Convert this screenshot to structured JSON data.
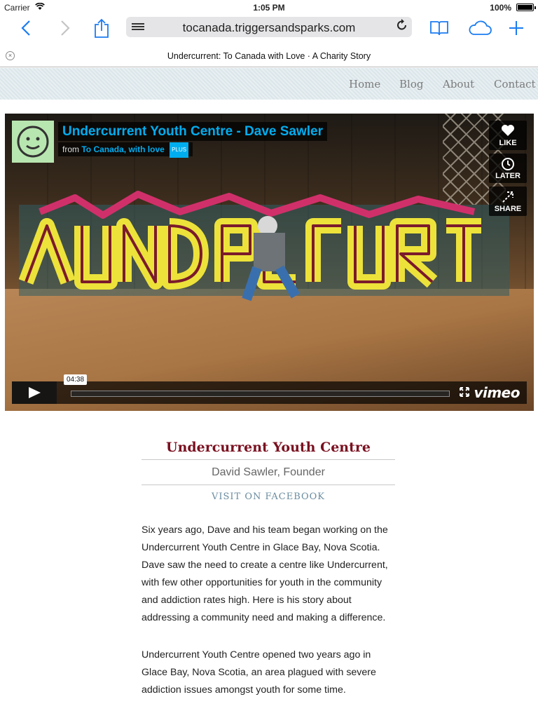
{
  "status_bar": {
    "carrier": "Carrier",
    "time": "1:05 PM",
    "battery": "100%"
  },
  "browser": {
    "url": "tocanada.triggersandsparks.com",
    "tab_title": "Undercurrent: To Canada with Love · A Charity Story",
    "accent_color": "#1b7cf2"
  },
  "site_nav": {
    "items": [
      "Home",
      "Blog",
      "About",
      "Contact"
    ]
  },
  "video": {
    "title": "Undercurrent Youth Centre - Dave Sawler",
    "from_label": "from",
    "channel": "To Canada, with love",
    "badge": "PLUS",
    "side_buttons": [
      "LIKE",
      "LATER",
      "SHARE"
    ],
    "duration": "04:38",
    "player_logo": "vimeo",
    "progress": 0
  },
  "article": {
    "title": "Undercurrent Youth Centre",
    "subtitle": "David Sawler, Founder",
    "link": "VISIT ON FACEBOOK",
    "paragraphs": [
      "Six years ago, Dave and his team began working on the Undercurrent Youth Centre in Glace Bay, Nova Scotia. Dave saw the need to create a centre like Undercurrent, with few other opportunities for youth in the community and addiction rates high. Here is his story about addressing a community need and making a difference.",
      "Undercurrent Youth Centre opened two years ago in Glace Bay, Nova Scotia, an area plagued with severe addiction issues amongst youth for some time."
    ],
    "title_color": "#7a1020",
    "link_color": "#6a8ca0"
  }
}
